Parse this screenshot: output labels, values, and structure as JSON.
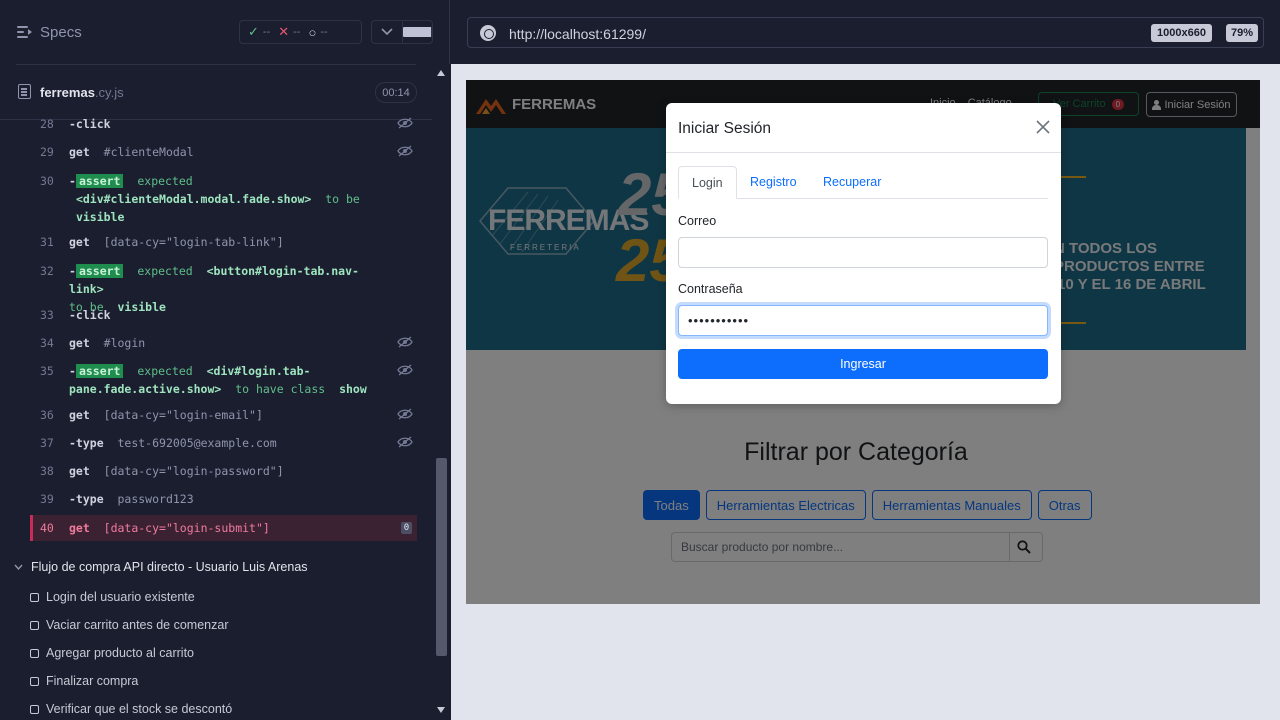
{
  "left": {
    "specs_label": "Specs",
    "stats": {
      "passed": "--",
      "failed": "--",
      "pending": "--"
    },
    "file": {
      "name": "ferremas",
      "ext": ".cy.js",
      "timer": "00:14"
    },
    "commands": [
      {
        "num": "28",
        "name": "-click",
        "eye": true
      },
      {
        "num": "29",
        "name": "get",
        "selector": "#clienteModal",
        "eye": true
      },
      {
        "num": "30",
        "name": "-assert",
        "text1": "expected",
        "text2": "<div#clienteModal.modal.fade.show>",
        "text3": "to be",
        "text4": "visible"
      },
      {
        "num": "31",
        "name": "get",
        "selector": "[data-cy=\"login-tab-link\"]"
      },
      {
        "num": "32",
        "name": "-assert",
        "text1": "expected",
        "text2": "<button#login-tab.nav-link>",
        "text3": "to be",
        "text4": "visible"
      },
      {
        "num": "33",
        "name": "-click"
      },
      {
        "num": "34",
        "name": "get",
        "selector": "#login",
        "eye": true
      },
      {
        "num": "35",
        "name": "-assert",
        "text1": "expected",
        "text2": "<div#login.tab-",
        "text2b": "pane.fade.active.show>",
        "text3": "to have class",
        "text4": "show",
        "eye": true
      },
      {
        "num": "36",
        "name": "get",
        "selector": "[data-cy=\"login-email\"]",
        "eye": true
      },
      {
        "num": "37",
        "name": "-type",
        "selector": "test-692005@example.com",
        "eye": true
      },
      {
        "num": "38",
        "name": "get",
        "selector": "[data-cy=\"login-password\"]"
      },
      {
        "num": "39",
        "name": "-type",
        "selector": "password123"
      },
      {
        "num": "40",
        "name": "get",
        "selector": "[data-cy=\"login-submit\"]",
        "badge": "0",
        "active": true
      }
    ],
    "suite": "Flujo de compra API directo - Usuario Luis Arenas",
    "tests": [
      "Login del usuario existente",
      "Vaciar carrito antes de comenzar",
      "Agregar producto al carrito",
      "Finalizar compra",
      "Verificar que el stock se descontó"
    ]
  },
  "browser": {
    "url": "http://localhost:61299/",
    "viewport": "1000x660",
    "zoom": "79%"
  },
  "app": {
    "brand": "FERREMAS",
    "nav_links": [
      "Inicio",
      "Catálogo"
    ],
    "cart_label": "Ver Carrito",
    "cart_count": "0",
    "login_label": "Iniciar Sesión",
    "banner": {
      "logo_text": "FERREMAS",
      "logo_sub": "FERRETERIA",
      "num_top": "25",
      "num_bottom": "25",
      "promo_lines": [
        "N TODOS LOS",
        "PRODUCTOS ENTRE",
        "L 10 Y EL 16 DE ABRIL"
      ]
    },
    "filter_title": "Filtrar por Categoría",
    "categories": [
      "Todas",
      "Herramientas Electricas",
      "Herramientas Manuales",
      "Otras"
    ],
    "search_placeholder": "Buscar producto por nombre..."
  },
  "modal": {
    "title": "Iniciar Sesión",
    "tabs": [
      "Login",
      "Registro",
      "Recuperar"
    ],
    "email_label": "Correo",
    "email_value": "",
    "password_label": "Contraseña",
    "password_value": "•••••••••••",
    "submit_label": "Ingresar"
  }
}
